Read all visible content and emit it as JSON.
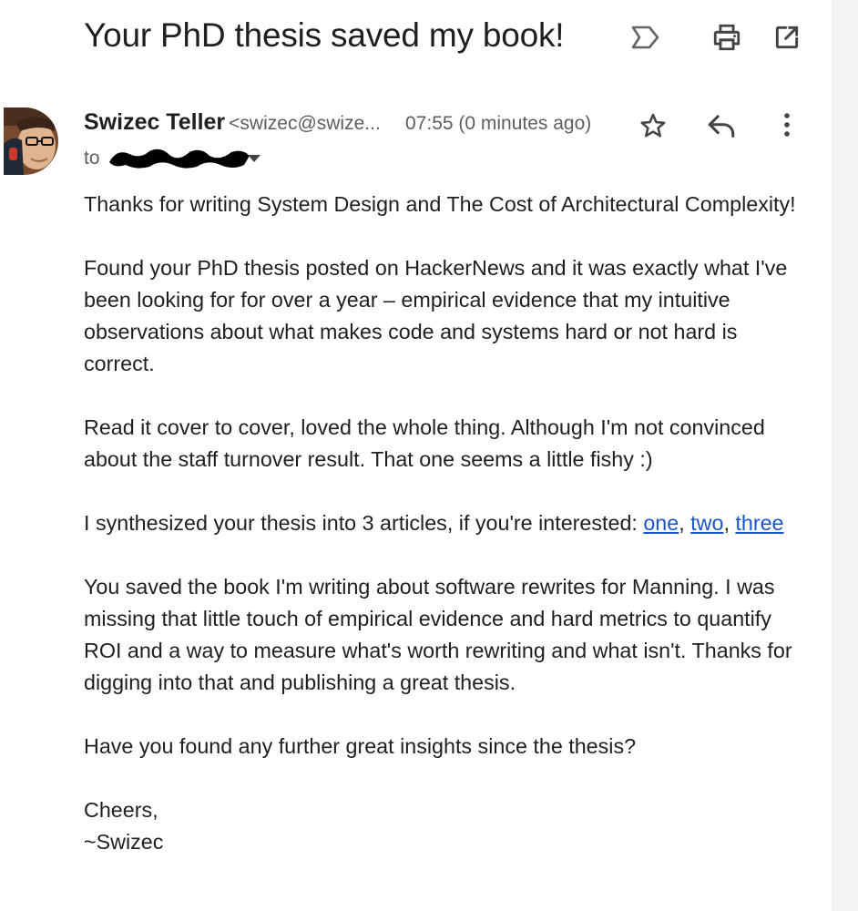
{
  "email": {
    "subject": "Your PhD thesis saved my book!",
    "sender": {
      "name": "Swizec Teller",
      "email_truncated": "<swizec@swize..."
    },
    "timestamp": "07:55 (0 minutes ago)",
    "to_label": "to",
    "body": {
      "p1": "Thanks for writing System Design and The Cost of Architectural Complexity!",
      "p2": "Found your PhD thesis posted on HackerNews and it was exactly what I've been looking for for over a year – empirical evidence that my intuitive observations about what makes code and systems hard or not hard is correct.",
      "p3": "Read it cover to cover, loved the whole thing. Although I'm not convinced about the staff turnover result. That one seems a little fishy :)",
      "p4_text": "I synthesized your thesis into 3 articles, if you're interested: ",
      "p4_links": [
        "one",
        "two",
        "three"
      ],
      "p4_sep": ", ",
      "p5": "You saved the book I'm writing about software rewrites for Manning. I was missing that little touch of empirical evidence and hard metrics to quantify ROI and a way to measure what's worth rewriting and what isn't. Thanks for digging into that and publishing a great thesis.",
      "p6": "Have you found any further great insights since the thesis?",
      "signoff": "Cheers,",
      "signature": "~Swizec"
    }
  },
  "icons": {
    "subject_row": [
      "important-marker-icon",
      "print-icon",
      "open-in-new-window-icon"
    ],
    "sender_row": [
      "star-icon",
      "reply-icon",
      "more-options-icon"
    ]
  },
  "colors": {
    "link": "#1a56c9",
    "text": "#1f1f1f",
    "secondary_text": "#5e5e5e",
    "gutter": "#f2f3f5"
  }
}
